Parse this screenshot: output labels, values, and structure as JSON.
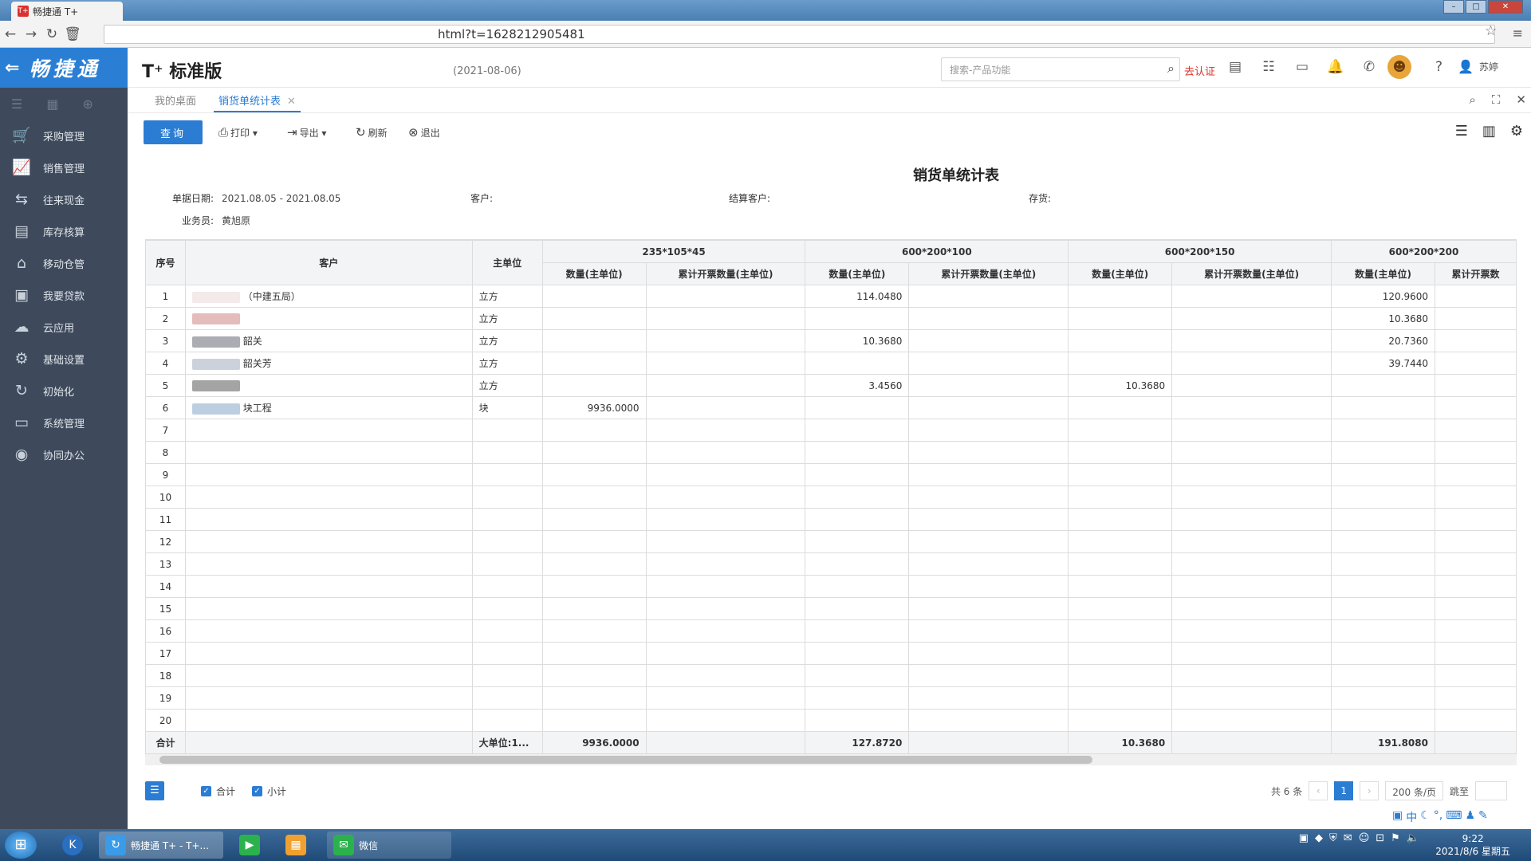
{
  "browser": {
    "tab_title": "畅捷通 T+",
    "url": "html?t=1628212905481"
  },
  "brand": {
    "logo": "畅捷通",
    "product": "T⁺ 标准版",
    "date": "(2021-08-06)"
  },
  "header": {
    "search_placeholder": "搜索-产品功能",
    "cert": "去认证",
    "user": "苏婷"
  },
  "sidebar": {
    "items": [
      {
        "label": "采购管理",
        "icon": "cart-icon"
      },
      {
        "label": "销售管理",
        "icon": "sales-chart-icon"
      },
      {
        "label": "往来现金",
        "icon": "exchange-icon"
      },
      {
        "label": "库存核算",
        "icon": "warehouse-icon"
      },
      {
        "label": "移动仓管",
        "icon": "mobile-warehouse-icon"
      },
      {
        "label": "我要贷款",
        "icon": "money-icon"
      },
      {
        "label": "云应用",
        "icon": "cloud-icon"
      },
      {
        "label": "基础设置",
        "icon": "gear-icon"
      },
      {
        "label": "初始化",
        "icon": "refresh-icon"
      },
      {
        "label": "系统管理",
        "icon": "monitor-icon"
      },
      {
        "label": "协同办公",
        "icon": "collab-icon"
      }
    ]
  },
  "tabs": {
    "home": "我的桌面",
    "active": "销货单统计表"
  },
  "toolbar": {
    "query": "查询",
    "print": "打印",
    "export": "导出",
    "refresh": "刷新",
    "exit": "退出"
  },
  "report": {
    "title": "销货单统计表",
    "filters": {
      "date_label": "单据日期:",
      "date_value": "2021.08.05 - 2021.08.05",
      "customer_label": "客户:",
      "settle_label": "结算客户:",
      "stock_label": "存货:",
      "salesman_label": "业务员:",
      "salesman_value": "黄旭原"
    }
  },
  "table": {
    "col_seq": "序号",
    "col_customer": "客户",
    "col_unit": "主单位",
    "groups": [
      "235*105*45",
      "600*200*100",
      "600*200*150",
      "600*200*200"
    ],
    "sub_qty": "数量(主单位)",
    "sub_cum": "累计开票数量(主单位)",
    "sub_cum_cut": "累计开票数",
    "rows": [
      {
        "seq": "1",
        "customer": "（中建五局）",
        "unit": "立方",
        "v": [
          "",
          "",
          "114.0480",
          "",
          "",
          "",
          "120.9600",
          ""
        ]
      },
      {
        "seq": "2",
        "customer": "",
        "unit": "立方",
        "v": [
          "",
          "",
          "",
          "",
          "",
          "",
          "10.3680",
          ""
        ]
      },
      {
        "seq": "3",
        "customer": "韶关",
        "unit": "立方",
        "v": [
          "",
          "",
          "10.3680",
          "",
          "",
          "",
          "20.7360",
          ""
        ]
      },
      {
        "seq": "4",
        "customer": "韶关芳",
        "unit": "立方",
        "v": [
          "",
          "",
          "",
          "",
          "",
          "",
          "39.7440",
          ""
        ]
      },
      {
        "seq": "5",
        "customer": "",
        "unit": "立方",
        "v": [
          "",
          "",
          "3.4560",
          "",
          "10.3680",
          "",
          "",
          ""
        ]
      },
      {
        "seq": "6",
        "customer": "块工程",
        "unit": "块",
        "v": [
          "9936.0000",
          "",
          "",
          "",
          "",
          "",
          "",
          ""
        ]
      },
      {
        "seq": "7",
        "customer": "",
        "unit": "",
        "v": [
          "",
          "",
          "",
          "",
          "",
          "",
          "",
          ""
        ]
      },
      {
        "seq": "8",
        "customer": "",
        "unit": "",
        "v": [
          "",
          "",
          "",
          "",
          "",
          "",
          "",
          ""
        ]
      },
      {
        "seq": "9",
        "customer": "",
        "unit": "",
        "v": [
          "",
          "",
          "",
          "",
          "",
          "",
          "",
          ""
        ]
      },
      {
        "seq": "10",
        "customer": "",
        "unit": "",
        "v": [
          "",
          "",
          "",
          "",
          "",
          "",
          "",
          ""
        ]
      },
      {
        "seq": "11",
        "customer": "",
        "unit": "",
        "v": [
          "",
          "",
          "",
          "",
          "",
          "",
          "",
          ""
        ]
      },
      {
        "seq": "12",
        "customer": "",
        "unit": "",
        "v": [
          "",
          "",
          "",
          "",
          "",
          "",
          "",
          ""
        ]
      },
      {
        "seq": "13",
        "customer": "",
        "unit": "",
        "v": [
          "",
          "",
          "",
          "",
          "",
          "",
          "",
          ""
        ]
      },
      {
        "seq": "14",
        "customer": "",
        "unit": "",
        "v": [
          "",
          "",
          "",
          "",
          "",
          "",
          "",
          ""
        ]
      },
      {
        "seq": "15",
        "customer": "",
        "unit": "",
        "v": [
          "",
          "",
          "",
          "",
          "",
          "",
          "",
          ""
        ]
      },
      {
        "seq": "16",
        "customer": "",
        "unit": "",
        "v": [
          "",
          "",
          "",
          "",
          "",
          "",
          "",
          ""
        ]
      },
      {
        "seq": "17",
        "customer": "",
        "unit": "",
        "v": [
          "",
          "",
          "",
          "",
          "",
          "",
          "",
          ""
        ]
      },
      {
        "seq": "18",
        "customer": "",
        "unit": "",
        "v": [
          "",
          "",
          "",
          "",
          "",
          "",
          "",
          ""
        ]
      },
      {
        "seq": "19",
        "customer": "",
        "unit": "",
        "v": [
          "",
          "",
          "",
          "",
          "",
          "",
          "",
          ""
        ]
      },
      {
        "seq": "20",
        "customer": "",
        "unit": "",
        "v": [
          "",
          "",
          "",
          "",
          "",
          "",
          "",
          ""
        ]
      }
    ],
    "total": {
      "label": "合计",
      "unit": "大单位:1...",
      "v": [
        "9936.0000",
        "",
        "127.8720",
        "",
        "10.3680",
        "",
        "191.8080",
        ""
      ]
    }
  },
  "footer": {
    "chk_total": "合计",
    "chk_subtotal": "小计",
    "count": "共 6 条",
    "page": "1",
    "page_size": "200 条/页",
    "jump": "跳至"
  },
  "taskbar": {
    "task1": "畅捷通 T+ - T+...",
    "task2": "微信",
    "time": "9:22",
    "date": "2021/8/6 星期五"
  }
}
